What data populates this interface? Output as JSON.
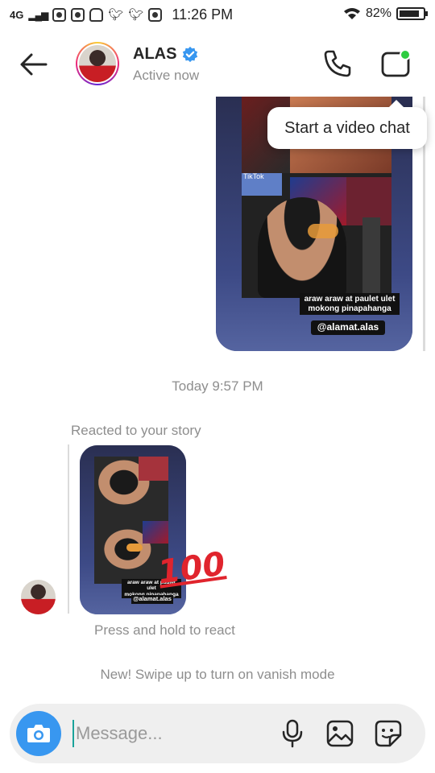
{
  "status_bar": {
    "network": "4G",
    "time": "11:26 PM",
    "battery": "82%"
  },
  "header": {
    "name": "ALAS",
    "status": "Active now",
    "icons": [
      "back-arrow-icon",
      "verified-badge-icon",
      "phone-icon",
      "video-icon"
    ]
  },
  "tooltip": {
    "text": "Start a video chat"
  },
  "story_shared": {
    "tiktok_label": "TikTok",
    "caption_line1": "araw araw at paulet ulet",
    "caption_line2": "mokong pinapahanga",
    "handle": "@alamat.alas"
  },
  "chat": {
    "timestamp": "Today 9:57 PM",
    "reacted_label": "Reacted to your story",
    "reaction_emoji": "100",
    "story_caption_line1": "araw araw at paulet ulet",
    "story_caption_line2": "mokong pinapahanga",
    "story_handle": "@alamat.alas",
    "press_hint": "Press and hold to react",
    "vanish_hint": "New! Swipe up to turn on vanish mode"
  },
  "composer": {
    "placeholder": "Message..."
  },
  "colors": {
    "accent_blue": "#3897f0",
    "verified_blue": "#3897f0",
    "online_green": "#2ecc40",
    "muted_text": "#8e8e8e"
  }
}
